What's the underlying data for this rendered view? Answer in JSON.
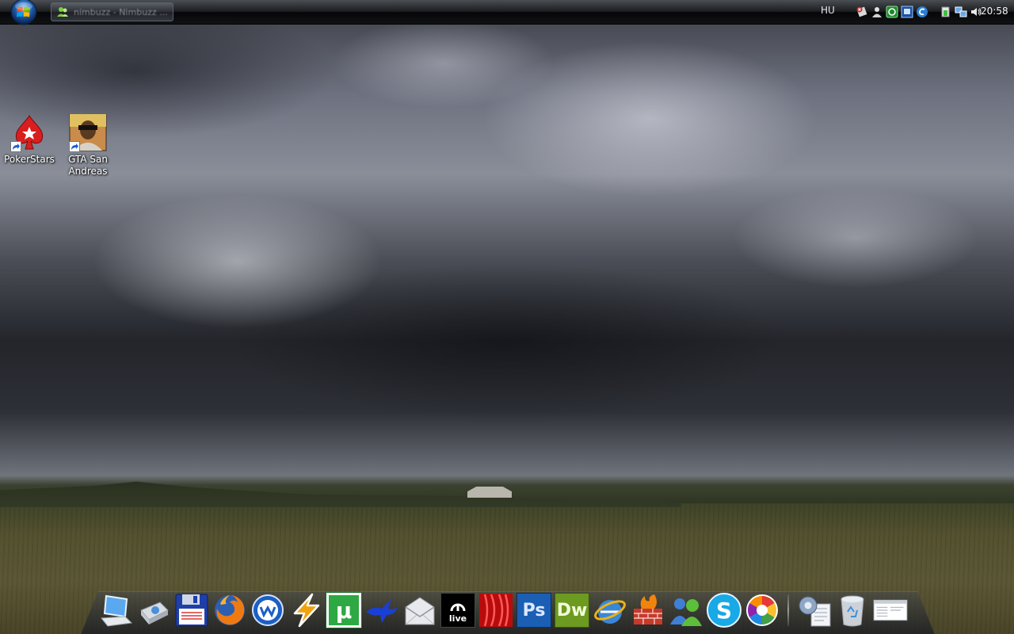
{
  "taskbar": {
    "task_button_label": "nimbuzz - Nimbuzz ...",
    "language": "HU",
    "clock": "20:58"
  },
  "desktop_icons": [
    {
      "label": "PokerStars"
    },
    {
      "label": "GTA San Andreas"
    }
  ],
  "dock": {
    "items": [
      {
        "name": "Computer",
        "icon": "laptop-icon"
      },
      {
        "name": "Network",
        "icon": "network-drive-icon"
      },
      {
        "name": "Save",
        "icon": "floppy-disk-icon"
      },
      {
        "name": "Firefox",
        "icon": "firefox-icon"
      },
      {
        "name": "Winamp",
        "icon": "winamp-icon"
      },
      {
        "name": "Lightning",
        "icon": "lightning-icon"
      },
      {
        "name": "uTorrent",
        "icon": "utorrent-icon",
        "glyph": "µ"
      },
      {
        "name": "Messenger",
        "icon": "bird-icon"
      },
      {
        "name": "Mail",
        "icon": "envelope-icon"
      },
      {
        "name": "Ableton Live",
        "icon": "live-icon",
        "glyph": "live"
      },
      {
        "name": "Flash",
        "icon": "flash-icon"
      },
      {
        "name": "Photoshop",
        "icon": "photoshop-icon",
        "glyph": "Ps"
      },
      {
        "name": "Dreamweaver",
        "icon": "dreamweaver-icon",
        "glyph": "Dw"
      },
      {
        "name": "Internet Explorer",
        "icon": "ie-icon"
      },
      {
        "name": "Firewall",
        "icon": "firewall-icon"
      },
      {
        "name": "Contacts",
        "icon": "contacts-icon"
      },
      {
        "name": "Skype",
        "icon": "skype-icon",
        "glyph": "S"
      },
      {
        "name": "Picasa",
        "icon": "picasa-icon"
      },
      {
        "name": "Control Panel",
        "icon": "settings-icon"
      },
      {
        "name": "Recycle Bin",
        "icon": "recycle-bin-icon"
      },
      {
        "name": "Window",
        "icon": "window-icon"
      }
    ]
  },
  "colors": {
    "utorrent_green": "#2ea843",
    "photoshop_blue": "#1a5fb4",
    "dreamweaver_green": "#6d9a20",
    "skype_blue": "#18a9e6"
  }
}
